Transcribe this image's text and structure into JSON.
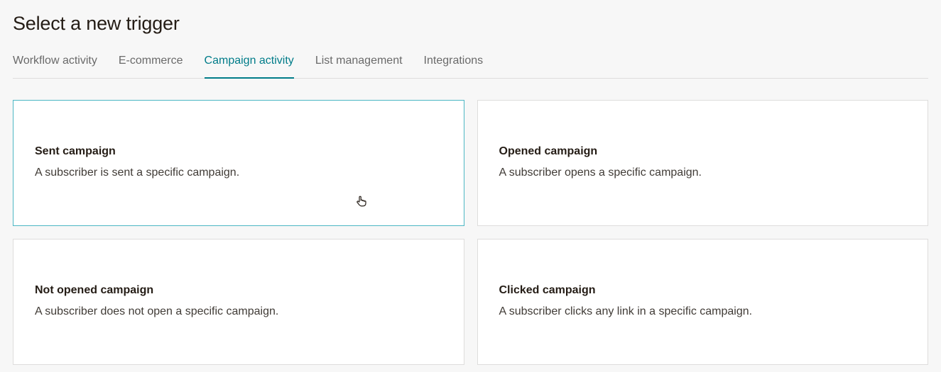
{
  "header": {
    "title": "Select a new trigger"
  },
  "tabs": [
    {
      "label": "Workflow activity",
      "active": false
    },
    {
      "label": "E-commerce",
      "active": false
    },
    {
      "label": "Campaign activity",
      "active": true
    },
    {
      "label": "List management",
      "active": false
    },
    {
      "label": "Integrations",
      "active": false
    }
  ],
  "cards": [
    {
      "title": "Sent campaign",
      "description": "A subscriber is sent a specific campaign.",
      "selected": true
    },
    {
      "title": "Opened campaign",
      "description": "A subscriber opens a specific campaign.",
      "selected": false
    },
    {
      "title": "Not opened campaign",
      "description": "A subscriber does not open a specific campaign.",
      "selected": false
    },
    {
      "title": "Clicked campaign",
      "description": "A subscriber clicks any link in a specific campaign.",
      "selected": false
    }
  ]
}
